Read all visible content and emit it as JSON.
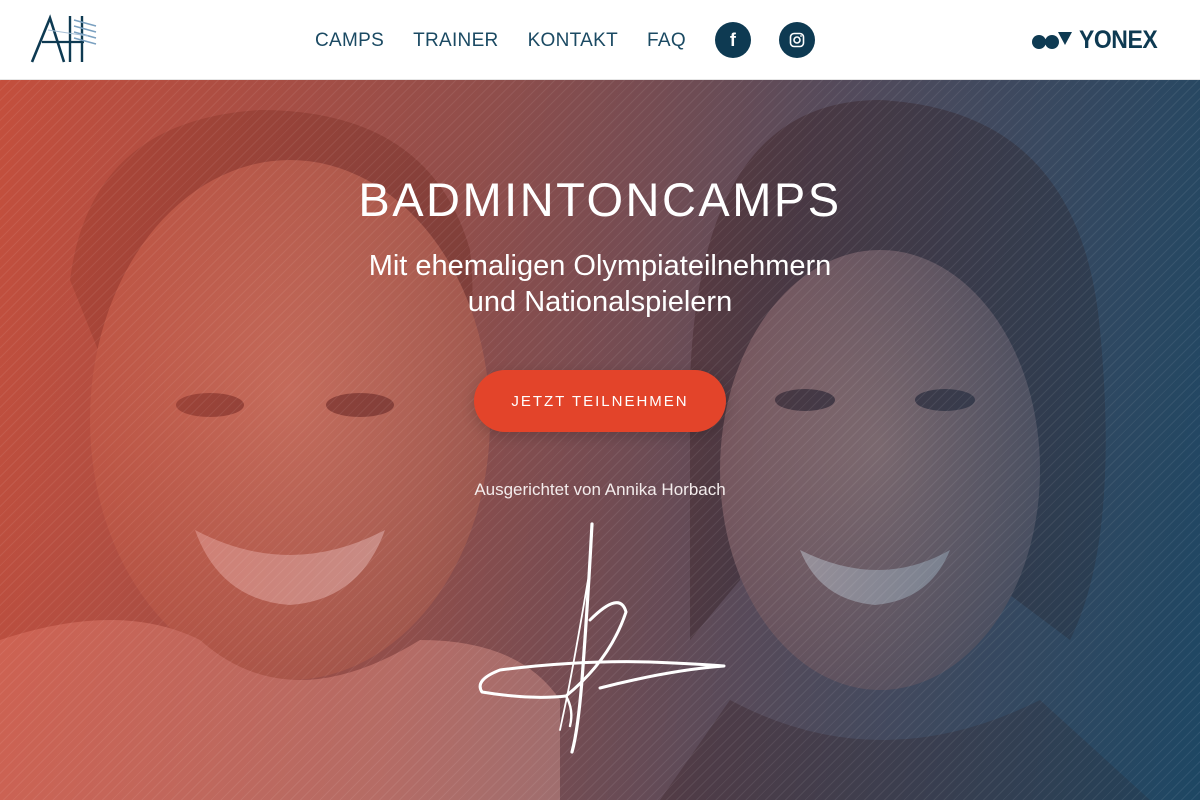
{
  "header": {
    "nav": [
      "CAMPS",
      "TRAINER",
      "KONTAKT",
      "FAQ"
    ],
    "social": [
      {
        "icon": "facebook-icon",
        "glyph": "f"
      },
      {
        "icon": "instagram-icon"
      }
    ],
    "sponsor": "YONEX",
    "logo_icon": "ah-monogram-logo"
  },
  "hero": {
    "title": "BADMINTONCAMPS",
    "subtitle_line1": "Mit ehemaligen Olympiateilnehmern",
    "subtitle_line2": "und Nationalspielern",
    "cta_label": "JETZT TEILNEHMEN",
    "host_text": "Ausgerichtet von Annika Horbach"
  },
  "colors": {
    "brand_navy": "#0e3a52",
    "nav_text": "#1b4a63",
    "cta": "#e3442a",
    "overlay_left": "#d6503c",
    "overlay_right": "#1a4664"
  }
}
